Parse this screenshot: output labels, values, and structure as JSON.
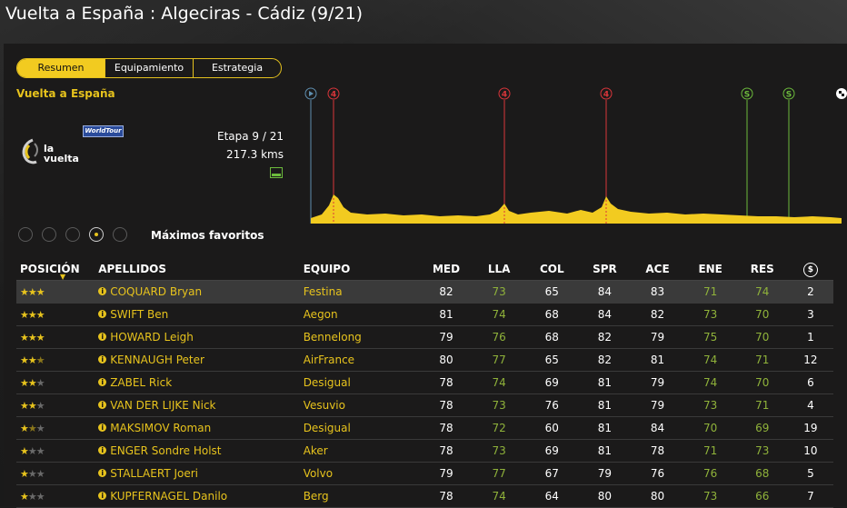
{
  "window": {
    "title": "Vuelta a España : Algeciras - Cádiz (9/21)"
  },
  "tabs": [
    {
      "label": "Resumen",
      "active": true
    },
    {
      "label": "Equipamiento",
      "active": false
    },
    {
      "label": "Estrategia",
      "active": false
    }
  ],
  "race": {
    "name": "Vuelta a España",
    "logo_text_1": "la",
    "logo_text_2": "vuelta",
    "badge": "WorldTour",
    "stage": "Etapa 9 / 21",
    "distance": "217.3 kms",
    "stage_icon": "flat-stage-icon"
  },
  "profile": {
    "markers": [
      {
        "label": "▶",
        "type": "start",
        "color": "#5f8fb0"
      },
      {
        "label": "4",
        "type": "climb",
        "color": "#d9353a"
      },
      {
        "label": "4",
        "type": "climb",
        "color": "#d9353a"
      },
      {
        "label": "4",
        "type": "climb",
        "color": "#d9353a"
      },
      {
        "label": "S",
        "type": "sprint",
        "color": "#6cbb3c"
      },
      {
        "label": "S",
        "type": "sprint",
        "color": "#6cbb3c"
      },
      {
        "label": "finish",
        "type": "finish",
        "color": "#ffffff"
      }
    ]
  },
  "filter": {
    "selected_index": 3,
    "label": "Máximos favoritos"
  },
  "table": {
    "headers": [
      "POSICIÓN",
      "APELLIDOS",
      "EQUIPO",
      "MED",
      "LLA",
      "COL",
      "SPR",
      "ACE",
      "ENE",
      "RES",
      "$"
    ],
    "rows": [
      {
        "stars": 3,
        "name": "COQUARD Bryan",
        "team": "Festina",
        "med": "82",
        "lla": "73",
        "col": "65",
        "spr": "84",
        "ace": "83",
        "ene": "71",
        "res": "74",
        "last": "2",
        "highlight": true
      },
      {
        "stars": 3,
        "name": "SWIFT Ben",
        "team": "Aegon",
        "med": "81",
        "lla": "74",
        "col": "68",
        "spr": "84",
        "ace": "82",
        "ene": "73",
        "res": "70",
        "last": "3"
      },
      {
        "stars": 3,
        "name": "HOWARD Leigh",
        "team": "Bennelong",
        "med": "79",
        "lla": "76",
        "col": "68",
        "spr": "82",
        "ace": "79",
        "ene": "75",
        "res": "70",
        "last": "1"
      },
      {
        "stars": 2.5,
        "name": "KENNAUGH Peter",
        "team": "AirFrance",
        "med": "80",
        "lla": "77",
        "col": "65",
        "spr": "82",
        "ace": "81",
        "ene": "74",
        "res": "71",
        "last": "12"
      },
      {
        "stars": 2,
        "name": "ZABEL Rick",
        "team": "Desigual",
        "med": "78",
        "lla": "74",
        "col": "69",
        "spr": "81",
        "ace": "79",
        "ene": "74",
        "res": "70",
        "last": "6"
      },
      {
        "stars": 2,
        "name": "VAN DER LIJKE Nick",
        "team": "Vesuvio",
        "med": "78",
        "lla": "73",
        "col": "76",
        "spr": "81",
        "ace": "79",
        "ene": "73",
        "res": "71",
        "last": "4"
      },
      {
        "stars": 1.5,
        "name": "MAKSIMOV Roman",
        "team": "Desigual",
        "med": "78",
        "lla": "72",
        "col": "60",
        "spr": "81",
        "ace": "84",
        "ene": "70",
        "res": "69",
        "last": "19"
      },
      {
        "stars": 1,
        "name": "ENGER Sondre Holst",
        "team": "Aker",
        "med": "78",
        "lla": "73",
        "col": "69",
        "spr": "81",
        "ace": "78",
        "ene": "71",
        "res": "73",
        "last": "10"
      },
      {
        "stars": 1,
        "name": "STALLAERT Joeri",
        "team": "Volvo",
        "med": "79",
        "lla": "77",
        "col": "67",
        "spr": "79",
        "ace": "76",
        "ene": "76",
        "res": "68",
        "last": "5"
      },
      {
        "stars": 1,
        "name": "KUPFERNAGEL Danilo",
        "team": "Berg",
        "med": "78",
        "lla": "74",
        "col": "64",
        "spr": "80",
        "ace": "80",
        "ene": "73",
        "res": "66",
        "last": "7"
      }
    ]
  },
  "colors": {
    "accent": "#e7c31d",
    "stat_green": "#8fb23a",
    "climb_red": "#d9353a",
    "sprint_green": "#6cbb3c"
  }
}
